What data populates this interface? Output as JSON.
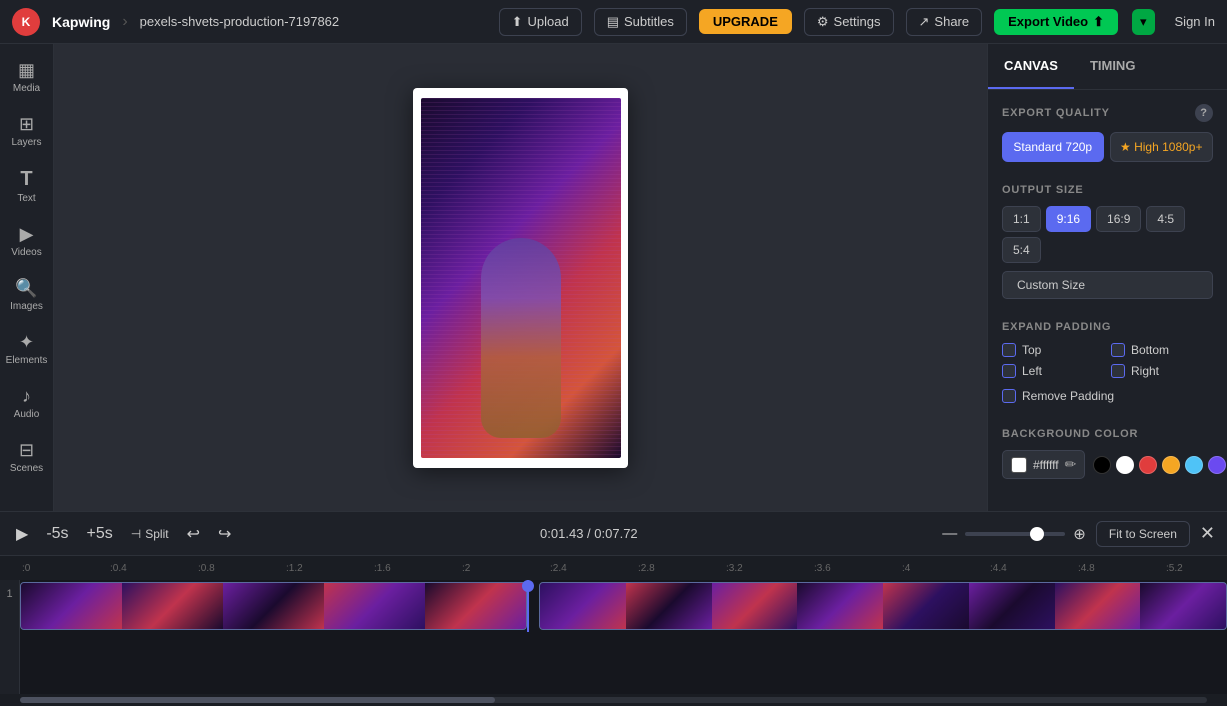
{
  "app": {
    "logo_text": "K",
    "brand": "Kapwing",
    "separator": "›",
    "filename": "pexels-shvets-production-7197862"
  },
  "topnav": {
    "upload_label": "Upload",
    "subtitles_label": "Subtitles",
    "upgrade_label": "UPGRADE",
    "settings_label": "Settings",
    "share_label": "Share",
    "export_label": "Export Video",
    "signin_label": "Sign In"
  },
  "sidebar": {
    "items": [
      {
        "id": "media",
        "label": "Media",
        "icon": "▦"
      },
      {
        "id": "layers",
        "label": "Layers",
        "icon": "⊞"
      },
      {
        "id": "text",
        "label": "Text",
        "icon": "T"
      },
      {
        "id": "videos",
        "label": "Videos",
        "icon": "▶"
      },
      {
        "id": "images",
        "label": "Images",
        "icon": "🔍"
      },
      {
        "id": "elements",
        "label": "Elements",
        "icon": "✦"
      },
      {
        "id": "audio",
        "label": "Audio",
        "icon": "♪"
      },
      {
        "id": "scenes",
        "label": "Scenes",
        "icon": "⊟"
      }
    ]
  },
  "panel": {
    "tab_canvas": "CANVAS",
    "tab_timing": "TIMING",
    "export_quality_title": "EXPORT QUALITY",
    "quality_standard": "Standard 720p",
    "quality_high": "★ High 1080p+",
    "output_size_title": "OUTPUT SIZE",
    "sizes": [
      "1:1",
      "9:16",
      "16:9",
      "4:5",
      "5:4"
    ],
    "active_size": "9:16",
    "custom_size_label": "Custom Size",
    "expand_padding_title": "EXPAND PADDING",
    "padding_top": "Top",
    "padding_bottom": "Bottom",
    "padding_left": "Left",
    "padding_right": "Right",
    "remove_padding": "Remove Padding",
    "bg_color_title": "BACKGROUND COLOR",
    "bg_hex": "#ffffff",
    "bg_swatches": [
      "#000000",
      "#ffffff",
      "#e03d3d",
      "#f5a623",
      "#4fc3f7",
      "#6b4af0"
    ]
  },
  "timeline": {
    "time_current": "0:01.43",
    "time_total": "0:07.72",
    "skip_back": "-5s",
    "skip_fwd": "+5s",
    "split_label": "Split",
    "fit_screen_label": "Fit to Screen",
    "ruler_marks": [
      ":0",
      ":0.4",
      ":0.8",
      ":1.2",
      ":1.6",
      ":2",
      ":2.4",
      ":2.8",
      ":3.2",
      ":3.6",
      ":4",
      ":4.4",
      ":4.8",
      ":5.2"
    ]
  },
  "colors": {
    "accent": "#5b6af0",
    "bg_dark": "#1a1d23",
    "bg_panel": "#1e2128",
    "bg_mid": "#2d3139",
    "border": "#2d3139"
  }
}
